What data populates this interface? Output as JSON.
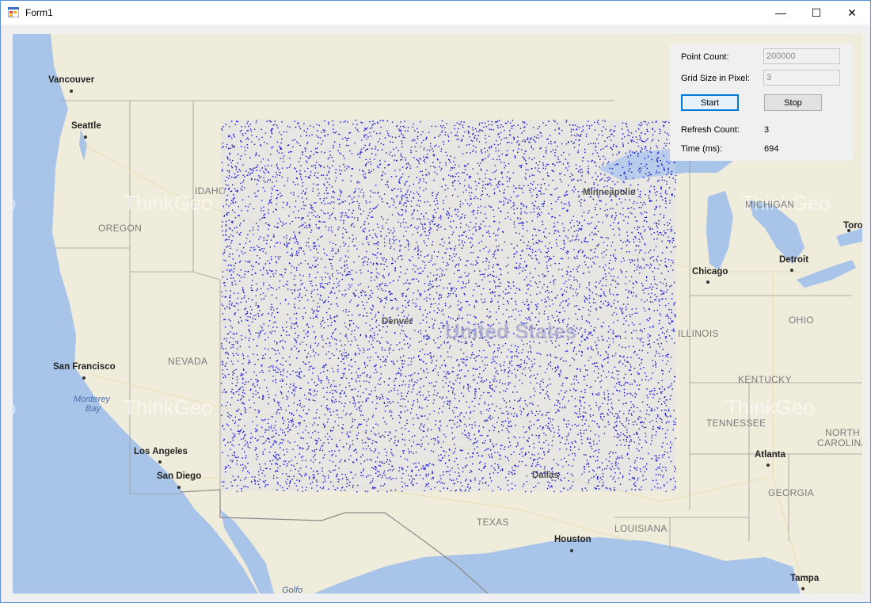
{
  "window": {
    "title": "Form1",
    "minimize_glyph": "—",
    "maximize_glyph": "☐",
    "close_glyph": "✕"
  },
  "panel": {
    "point_count_label": "Point Count:",
    "point_count_value": "200000",
    "grid_size_label": "Grid Size in Pixel:",
    "grid_size_value": "3",
    "start_label": "Start",
    "stop_label": "Stop",
    "refresh_count_label": "Refresh Count:",
    "refresh_count_value": "3",
    "time_label": "Time (ms):",
    "time_value": "694"
  },
  "map": {
    "colors": {
      "land": "#f0ecdc",
      "water": "#a8c4e8",
      "points": "#1010d8",
      "border": "#8a8a8a"
    },
    "cities": [
      "Vancouver",
      "Seattle",
      "San Francisco",
      "Los Angeles",
      "San Diego",
      "Chicago",
      "Detroit",
      "Toro",
      "Atlanta",
      "Houston",
      "Tampa",
      "Minneapolis",
      "Denver",
      "Dallas"
    ],
    "states": [
      "IDAHO",
      "OREGON",
      "NEVADA",
      "MICHIGAN",
      "ILLINOIS",
      "OHIO",
      "KENTUCKY",
      "TENNESSEE",
      "NORTH",
      "CAROLINA",
      "GEORGIA",
      "TEXAS",
      "LOUISIANA"
    ],
    "water_labels": [
      "Monterey",
      "Bay",
      "Golfo"
    ],
    "country_label": "United States",
    "watermark": "ThinkGeo"
  }
}
